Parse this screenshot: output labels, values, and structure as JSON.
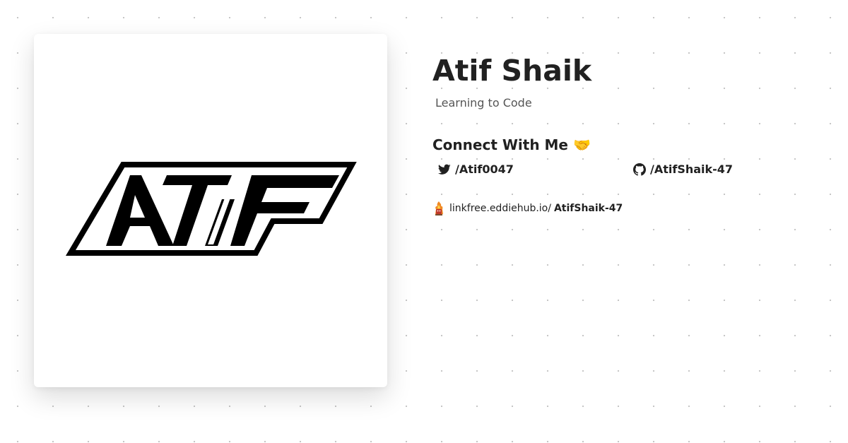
{
  "profile": {
    "name": "Atif Shaik",
    "bio": "Learning to Code",
    "avatar_text": "ATIF"
  },
  "connect": {
    "heading": "Connect With Me",
    "emoji": "🤝"
  },
  "socials": {
    "twitter": {
      "icon": "twitter-icon",
      "label": "/Atif0047"
    },
    "github": {
      "icon": "github-icon",
      "label": "/AtifShaik-47"
    }
  },
  "linkfree": {
    "icon": "linkfree-logo-icon",
    "domain": "linkfree.eddiehub.io/",
    "username": "AtifShaik-47"
  },
  "colors": {
    "text": "#212121",
    "muted": "#555555",
    "dots": "#c4c4c4",
    "logo": "#000000"
  }
}
